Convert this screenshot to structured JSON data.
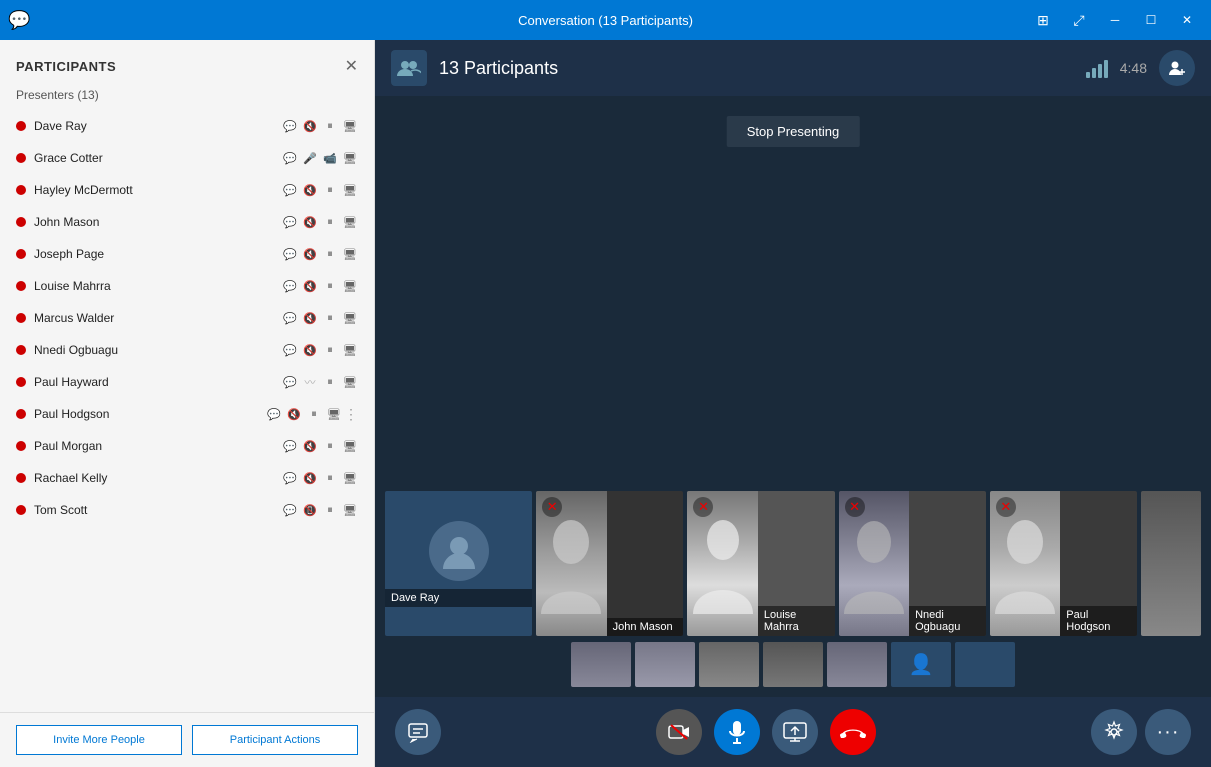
{
  "titleBar": {
    "appIcon": "💬",
    "title": "Conversation (13 Participants)",
    "controls": [
      "⊞",
      "⛶",
      "─",
      "☐",
      "✕"
    ]
  },
  "sidebar": {
    "title": "PARTICIPANTS",
    "presentersLabel": "Presenters (13)",
    "participants": [
      {
        "name": "Dave Ray",
        "active": true
      },
      {
        "name": "Grace Cotter",
        "active": true
      },
      {
        "name": "Hayley McDermott",
        "active": true
      },
      {
        "name": "John Mason",
        "active": true
      },
      {
        "name": "Joseph Page",
        "active": true
      },
      {
        "name": "Louise Mahrra",
        "active": true
      },
      {
        "name": "Marcus Walder",
        "active": true
      },
      {
        "name": "Nnedi Ogbuagu",
        "active": true
      },
      {
        "name": "Paul Hayward",
        "active": true
      },
      {
        "name": "Paul Hodgson",
        "active": true
      },
      {
        "name": "Paul Morgan",
        "active": true
      },
      {
        "name": "Rachael Kelly",
        "active": true
      },
      {
        "name": "Tom Scott",
        "active": true
      }
    ],
    "inviteButton": "Invite More People",
    "actionsButton": "Participant Actions"
  },
  "callHeader": {
    "participantCount": "13 Participants",
    "timer": "4:48"
  },
  "callArea": {
    "stopPresentingBtn": "Stop Presenting",
    "videoTiles": [
      {
        "name": "Dave Ray",
        "isAvatar": true,
        "muted": false
      },
      {
        "name": "John Mason",
        "muted": true
      },
      {
        "name": "Louise Mahrra",
        "muted": true
      },
      {
        "name": "Nnedi Ogbuagu",
        "muted": true
      },
      {
        "name": "Paul Hodgson",
        "muted": true
      }
    ],
    "thumbCount": 7
  },
  "callFooter": {
    "chatBtn": "💬",
    "muteVideoBtn": "🎥",
    "micBtn": "🎤",
    "screenBtn": "🖥",
    "endBtn": "📞",
    "settingsBtn": "⚙",
    "moreBtn": "···"
  }
}
